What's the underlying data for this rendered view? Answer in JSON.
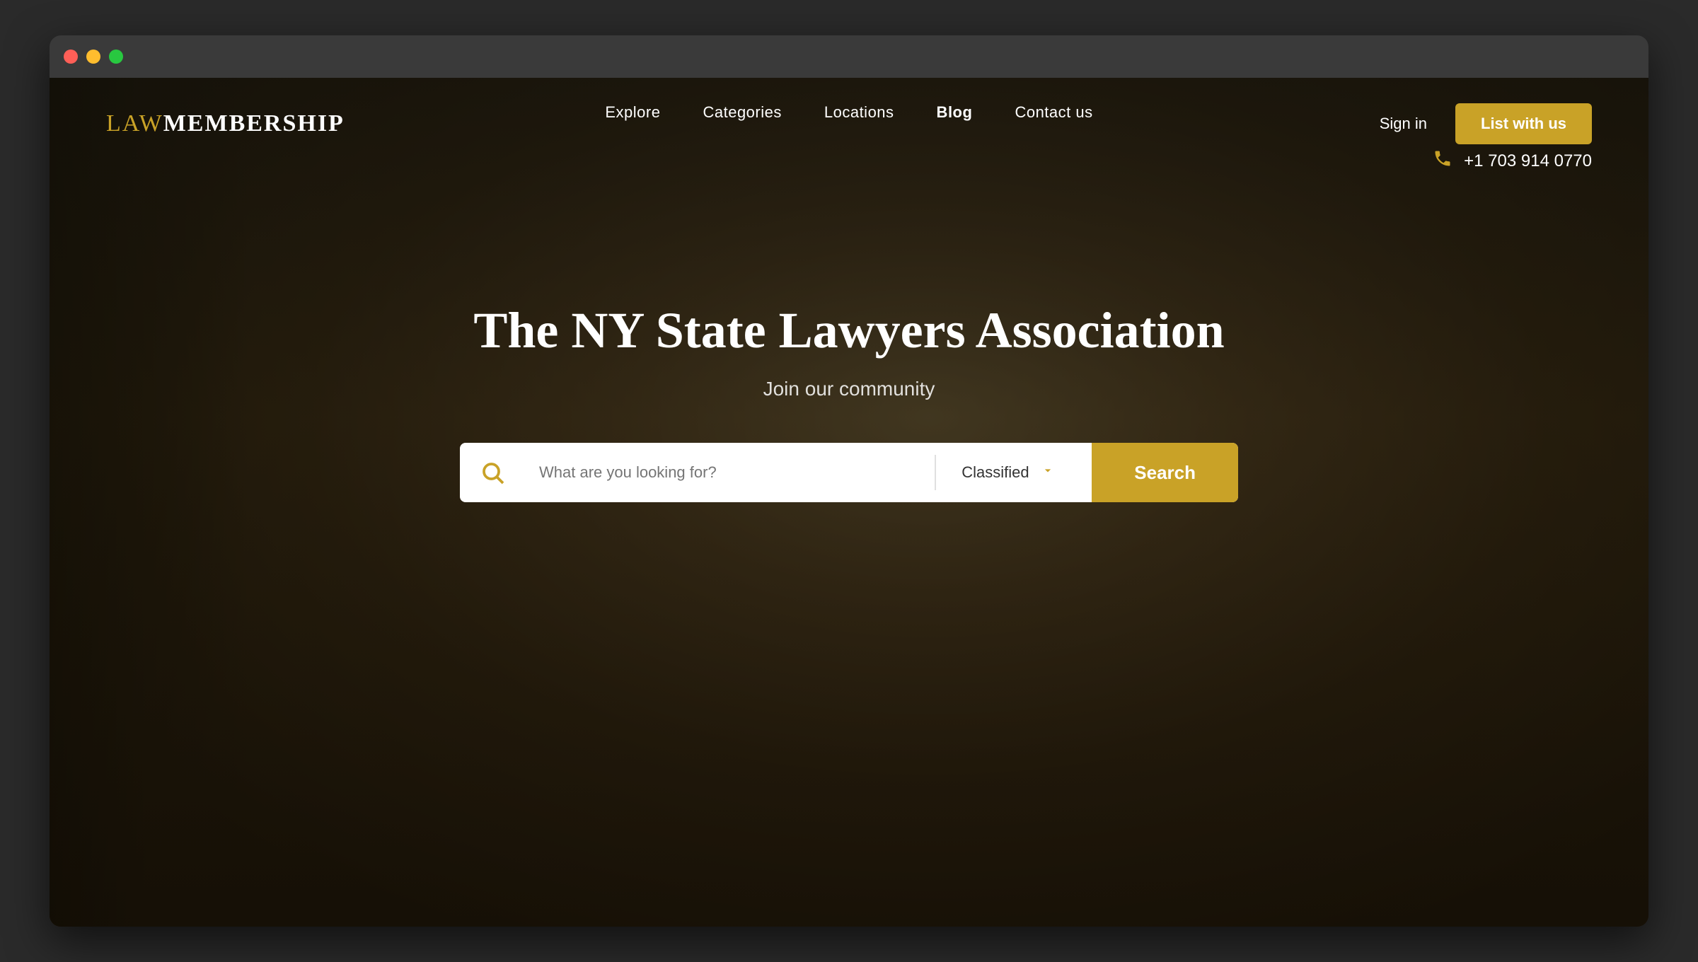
{
  "browser": {
    "traffic_lights": [
      "red",
      "yellow",
      "green"
    ]
  },
  "header": {
    "logo_law": "LAW",
    "logo_membership": "MEMBERSHIP"
  },
  "nav": {
    "links": [
      {
        "label": "Explore",
        "active": false
      },
      {
        "label": "Categories",
        "active": false
      },
      {
        "label": "Locations",
        "active": false
      },
      {
        "label": "Blog",
        "active": true
      },
      {
        "label": "Contact us",
        "active": false
      }
    ],
    "sign_in": "Sign in",
    "list_with_us": "List with us",
    "phone_number": "+1 703 914 0770"
  },
  "hero": {
    "title": "The NY State Lawyers Association",
    "subtitle": "Join our community"
  },
  "search": {
    "placeholder": "What are you looking for?",
    "category": "Classified",
    "button_label": "Search",
    "icon": "🔍"
  },
  "colors": {
    "gold": "#c9a227",
    "white": "#ffffff",
    "dark_overlay": "rgba(20,15,5,0.65)"
  }
}
